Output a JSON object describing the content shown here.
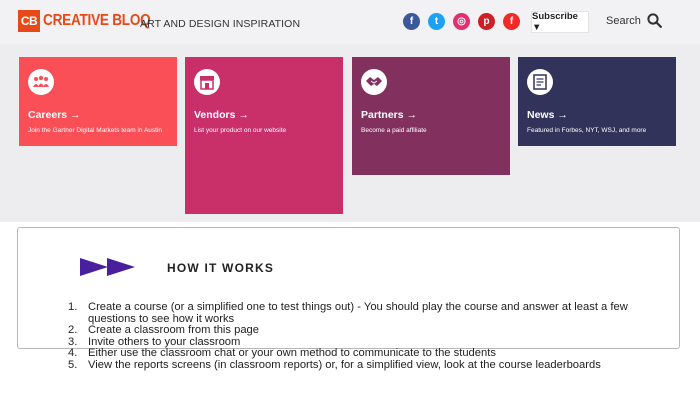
{
  "header": {
    "logo_badge": "CB",
    "logo_text": "CREATIVE BLOQ",
    "tagline": "ART AND DESIGN INSPIRATION",
    "subscribe_label": "Subscribe ▼",
    "search_label": "Search",
    "social": [
      {
        "name": "facebook",
        "glyph": "f",
        "color": "#3b5998"
      },
      {
        "name": "twitter",
        "glyph": "t",
        "color": "#1da1f2"
      },
      {
        "name": "instagram",
        "glyph": "◎",
        "color": "#e1306c"
      },
      {
        "name": "pinterest",
        "glyph": "p",
        "color": "#cb2027"
      },
      {
        "name": "flipboard",
        "glyph": "f",
        "color": "#f52828"
      }
    ]
  },
  "cards": [
    {
      "title": "Careers →",
      "desc": "Join the Gartner Digital Markets team in Austin",
      "color": "#fa4f57",
      "icon": "people-icon"
    },
    {
      "title": "Vendors →",
      "desc": "List your product on our website",
      "color": "#c9306a",
      "icon": "storefront-icon"
    },
    {
      "title": "Partners →",
      "desc": "Become a paid affiliate",
      "color": "#82315f",
      "icon": "handshake-icon"
    },
    {
      "title": "News →",
      "desc": "Featured in Forbes, NYT, WSJ, and more",
      "color": "#32335a",
      "icon": "newspaper-icon"
    }
  ],
  "how_it_works": {
    "title": "HOW IT WORKS",
    "steps": [
      "Create a course (or a simplified one to test things out) - You should play the course and answer at least a few questions to see how it works",
      "Create a classroom from this page",
      "Invite others to your classroom",
      "Either use the classroom chat or your own method to communicate to the students",
      "View the reports screens (in classroom reports) or, for a simplified view, look at the course leaderboards"
    ]
  }
}
